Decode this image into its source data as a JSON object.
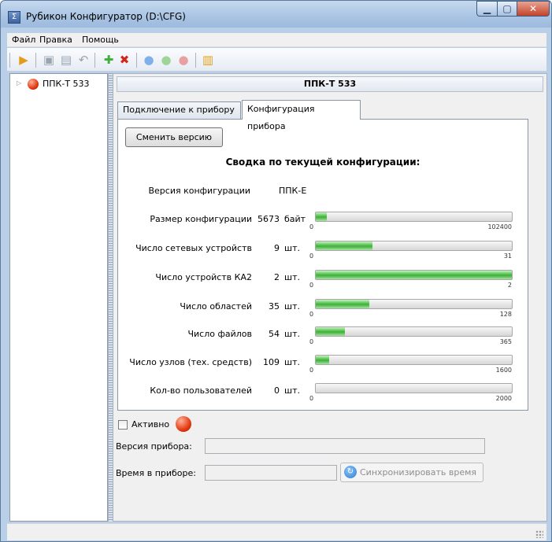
{
  "window": {
    "title": "Рубикон Конфигуратор (D:\\CFG)",
    "icon": "app-icon"
  },
  "menu": {
    "items": [
      "Файл",
      "Правка",
      "Помощь"
    ]
  },
  "tree": {
    "node_label": "ППК-Т 533",
    "node_status_color": "#e33a12"
  },
  "panel": {
    "header": "ППК-Т 533",
    "tabs": [
      "Подключение к прибору",
      "Конфигурация прибора"
    ],
    "active_tab": "Конфигурация прибора",
    "change_version_button": "Сменить версию",
    "summary_title": "Сводка по текущей конфигурации:",
    "version_label": "Версия конфигурации",
    "version_value": "ППК-Е"
  },
  "stats": [
    {
      "label": "Размер конфигурации",
      "value": "5673",
      "unit": "байт",
      "min": "0",
      "max": "102400",
      "fraction": 0.055
    },
    {
      "label": "Число сетевых устройств",
      "value": "9",
      "unit": "шт.",
      "min": "0",
      "max": "31",
      "fraction": 0.29
    },
    {
      "label": "Число устройств КА2",
      "value": "2",
      "unit": "шт.",
      "min": "0",
      "max": "2",
      "fraction": 1.0
    },
    {
      "label": "Число областей",
      "value": "35",
      "unit": "шт.",
      "min": "0",
      "max": "128",
      "fraction": 0.273
    },
    {
      "label": "Число файлов",
      "value": "54",
      "unit": "шт.",
      "min": "0",
      "max": "365",
      "fraction": 0.148
    },
    {
      "label": "Число узлов (тех. средств)",
      "value": "109",
      "unit": "шт.",
      "min": "0",
      "max": "1600",
      "fraction": 0.068
    },
    {
      "label": "Кол-во пользователей",
      "value": "0",
      "unit": "шт.",
      "min": "0",
      "max": "2000",
      "fraction": 0.0
    }
  ],
  "bottom": {
    "active_label": "Активно",
    "active_checked": false,
    "firmware_label": "Версия прибора:",
    "firmware_value": "",
    "time_label": "Время в приборе:",
    "time_value": "",
    "sync_button": "Синхронизировать время"
  },
  "colors": {
    "progress_fill": "#4cc046",
    "status_red": "#e33a12",
    "window_frame": "#b9cfe8"
  }
}
